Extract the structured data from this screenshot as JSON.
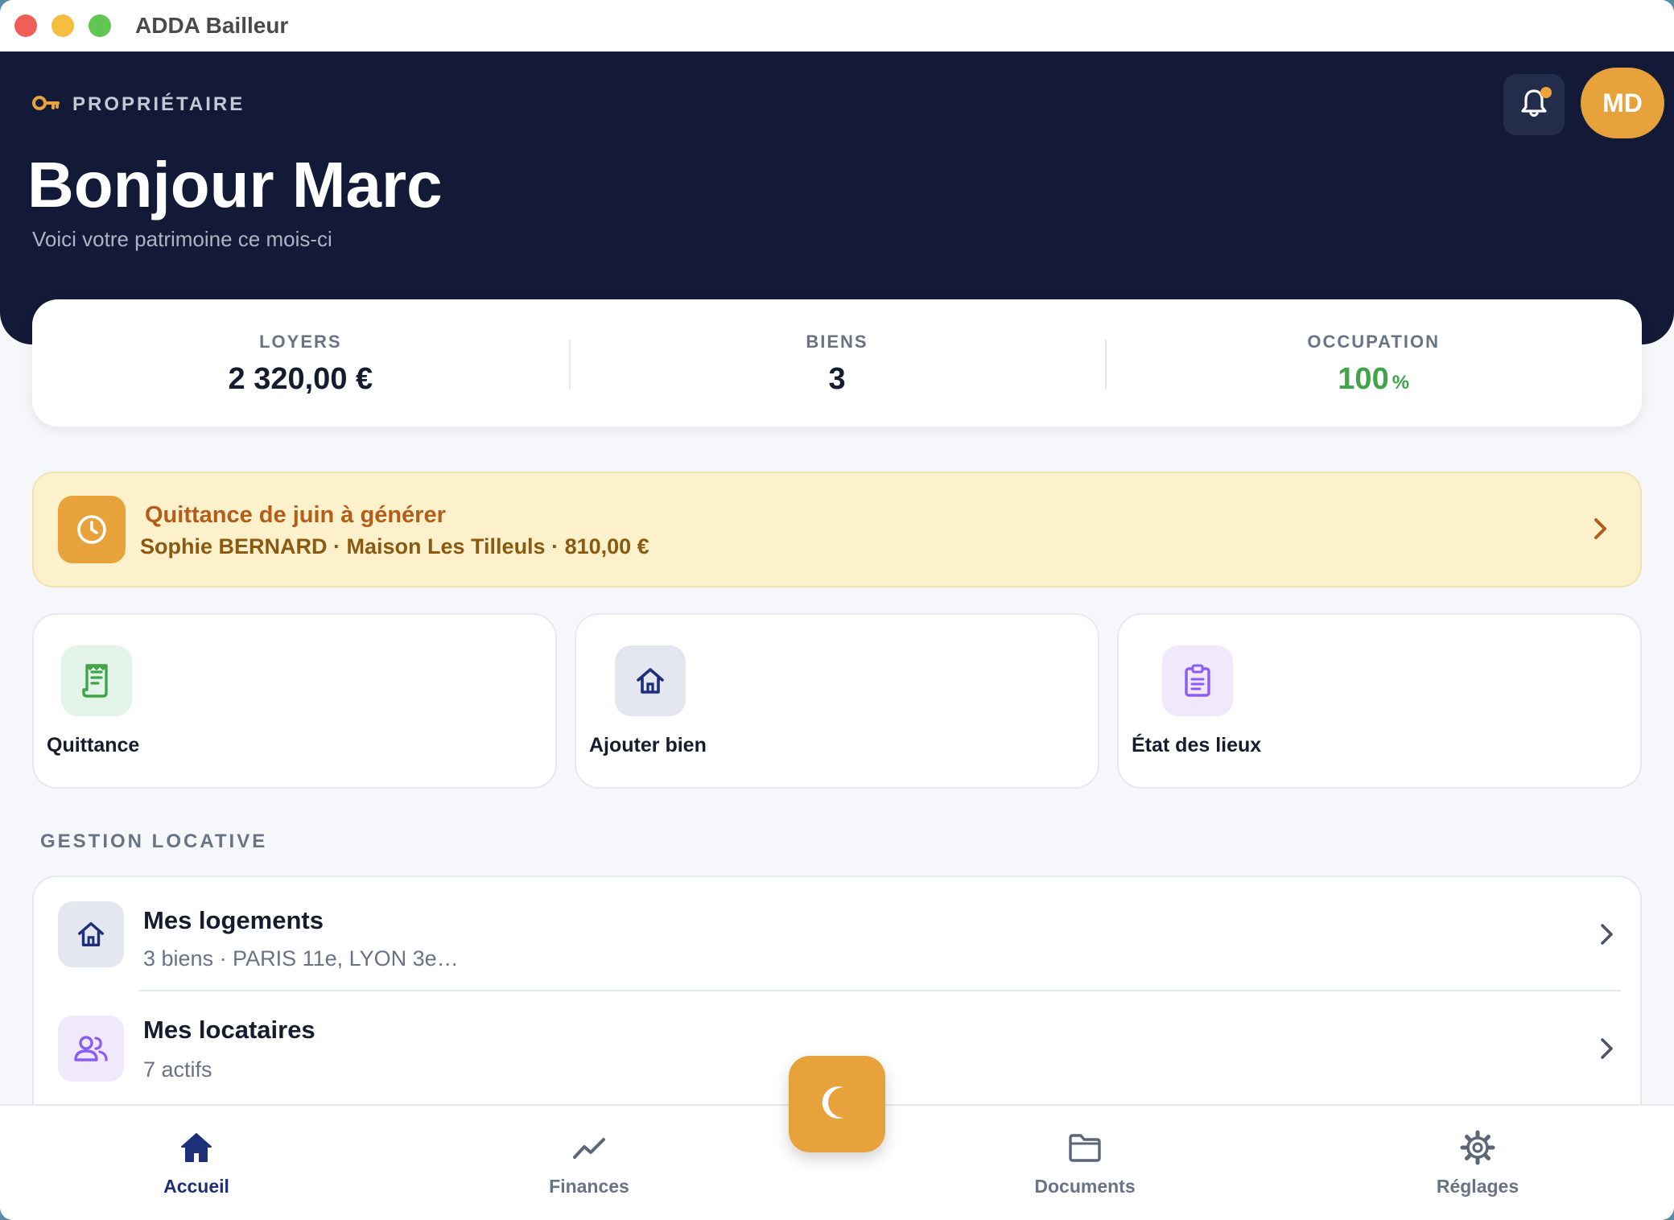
{
  "window": {
    "title": "ADDA Bailleur"
  },
  "header": {
    "role_label": "PROPRIÉTAIRE",
    "greeting": "Bonjour Marc",
    "subtitle": "Voici votre patrimoine ce mois-ci",
    "avatar_initials": "MD"
  },
  "stats": {
    "rent": {
      "label": "LOYERS",
      "value": "2 320,00 €"
    },
    "properties": {
      "label": "BIENS",
      "value": "3"
    },
    "occupancy": {
      "label": "OCCUPATION",
      "value": "100",
      "unit": "%"
    }
  },
  "alert": {
    "title": "Quittance de juin à générer",
    "subtitle": "Sophie BERNARD · Maison Les Tilleuls · 810,00 €"
  },
  "actions": [
    {
      "label": "Quittance"
    },
    {
      "label": "Ajouter bien"
    },
    {
      "label": "État des lieux"
    }
  ],
  "section": {
    "title": "GESTION LOCATIVE",
    "items": [
      {
        "title": "Mes logements",
        "subtitle": "3 biens · PARIS 11e, LYON 3e…"
      },
      {
        "title": "Mes locataires",
        "subtitle": "7 actifs"
      }
    ]
  },
  "tabs": [
    {
      "label": "Accueil"
    },
    {
      "label": "Finances"
    },
    {
      "label": "Documents"
    },
    {
      "label": "Réglages"
    }
  ],
  "colors": {
    "header_bg": "#121a38",
    "accent_orange": "#e8a23c",
    "success_green": "#3fa44a",
    "active_tab": "#1e2f7a"
  }
}
